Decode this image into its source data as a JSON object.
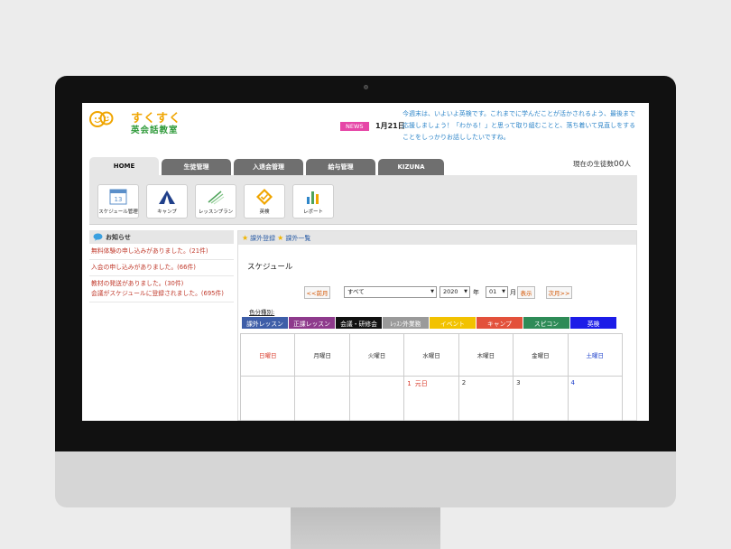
{
  "logo": {
    "line1": "すくすく",
    "line2": "英会話教室"
  },
  "news": {
    "badge": "NEWS",
    "date": "1月21日",
    "text": "今週末は、いよいよ英検です。これまでに学んだことが活かされるよう、最後まで応援しましょう！「わかる！」と思って取り組むことと、落ち着いて見直しをすることをしっかりお話ししたいですね。"
  },
  "tabs": [
    {
      "label": "HOME",
      "active": true
    },
    {
      "label": "生徒管理",
      "active": false
    },
    {
      "label": "入退会管理",
      "active": false
    },
    {
      "label": "給与管理",
      "active": false
    },
    {
      "label": "KIZUNA",
      "active": false
    }
  ],
  "student_count": {
    "prefix": "現在の生徒数",
    "value": "00",
    "suffix": "人"
  },
  "tools": [
    {
      "label": "スケジュール管理",
      "icon": "calendar-icon"
    },
    {
      "label": "キャンプ",
      "icon": "tent-icon"
    },
    {
      "label": "レッスンプラン",
      "icon": "lesson-plan-icon"
    },
    {
      "label": "英検",
      "icon": "check-badge-icon"
    },
    {
      "label": "レポート",
      "icon": "report-chart-icon"
    }
  ],
  "notices": {
    "title": "お知らせ",
    "items": [
      "無料体験の申し込みがありました。(21件)",
      "入会の申し込みがありました。(66件)",
      "教材の発送がありました。(30件)",
      "会議がスケジュールに登録されました。(695件)"
    ]
  },
  "schedule": {
    "links": [
      "課外登録",
      "課外一覧"
    ],
    "title": "スケジュール",
    "prev": "<<前月",
    "next": "次月>>",
    "category": "すべて",
    "year": "2020",
    "year_label": "年",
    "month": "01",
    "month_label": "月",
    "show": "表示",
    "legend_title": "色分種別:",
    "legend": [
      {
        "label": "課外レッスン",
        "color": "#3e5ea8"
      },
      {
        "label": "正課レッスン",
        "color": "#8e3a8c"
      },
      {
        "label": "会議・研修会",
        "color": "#111111"
      },
      {
        "label": "ﾚｯｽﾝ外業務",
        "color": "#9a9a9a"
      },
      {
        "label": "イベント",
        "color": "#f2c200"
      },
      {
        "label": "キャンプ",
        "color": "#e3513b"
      },
      {
        "label": "スピコン",
        "color": "#2e8b57"
      },
      {
        "label": "英検",
        "color": "#1c1ce8"
      }
    ],
    "weekdays": [
      "日曜日",
      "月曜日",
      "火曜日",
      "水曜日",
      "木曜日",
      "金曜日",
      "土曜日"
    ],
    "first_week": [
      "",
      "",
      "",
      "1",
      "2",
      "3",
      "4"
    ],
    "holiday": "元日"
  }
}
